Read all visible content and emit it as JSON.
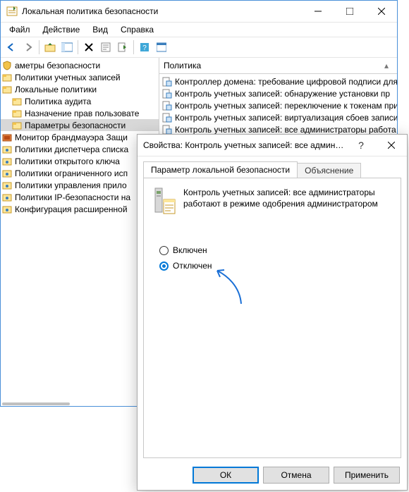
{
  "window": {
    "title": "Локальная политика безопасности",
    "menu": [
      "Файл",
      "Действие",
      "Вид",
      "Справка"
    ]
  },
  "tree": {
    "items": [
      {
        "label": "аметры безопасности",
        "level": 0,
        "icon": "shield"
      },
      {
        "label": "Политики учетных записей",
        "level": 0,
        "icon": "folder"
      },
      {
        "label": "Локальные политики",
        "level": 0,
        "icon": "folder"
      },
      {
        "label": "Политика аудита",
        "level": 1,
        "icon": "folder"
      },
      {
        "label": "Назначение прав пользовате",
        "level": 1,
        "icon": "folder"
      },
      {
        "label": "Параметры безопасности",
        "level": 1,
        "icon": "folder",
        "selected": true
      },
      {
        "label": "Монитор брандмауэра Защи",
        "level": 0,
        "icon": "folder-fw"
      },
      {
        "label": "Политики диспетчера списка",
        "level": 0,
        "icon": "net"
      },
      {
        "label": "Политики открытого ключа",
        "level": 0,
        "icon": "net"
      },
      {
        "label": "Политики ограниченного исп",
        "level": 0,
        "icon": "net"
      },
      {
        "label": "Политики управления прило",
        "level": 0,
        "icon": "net"
      },
      {
        "label": "Политики IP-безопасности на",
        "level": 0,
        "icon": "net"
      },
      {
        "label": "Конфигурация расширенной",
        "level": 0,
        "icon": "net"
      }
    ]
  },
  "list": {
    "header": "Политика",
    "rows": [
      "Контроллер домена: требование цифровой подписи для",
      "Контроль учетных записей: обнаружение установки пр",
      "Контроль учетных записей: переключение к токенам привязки как",
      "Контроль учетных записей: виртуализация сбоев записи",
      "Контроль учетных записей: все администраторы работа"
    ]
  },
  "dialog": {
    "title": "Свойства: Контроль учетных записей: все администрат...",
    "tabs": {
      "active": "Параметр локальной безопасности",
      "inactive": "Объяснение"
    },
    "policy_text": "Контроль учетных записей: все администраторы работают в режиме одобрения администратором",
    "radios": {
      "enabled": "Включен",
      "disabled": "Отключен",
      "value": "disabled"
    },
    "buttons": {
      "ok": "ОК",
      "cancel": "Отмена",
      "apply": "Применить"
    }
  }
}
